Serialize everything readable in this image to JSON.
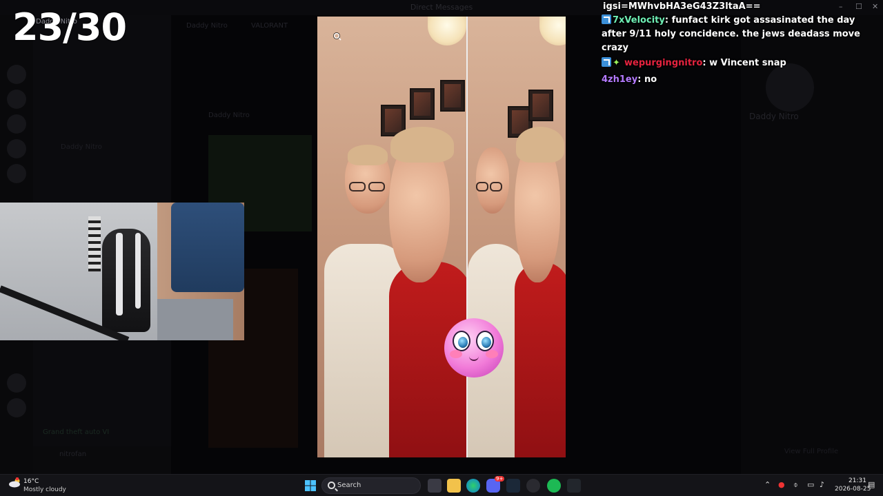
{
  "background": {
    "window_title": "Direct Messages",
    "dm_header_name": "Daddy Nitro",
    "dm_header_channel": "VALORANT",
    "server_name_top": "Daddy Nitro",
    "channel_user": "Daddy Nitro",
    "bg_message_author": "Daddy Nitro",
    "profile_name": "Daddy Nitro",
    "profile_button": "View Full Profile",
    "user_panel_name": "nitrofan",
    "bottom_channel": "Grand theft auto VI"
  },
  "overlay": {
    "counter": "23/30"
  },
  "chat": {
    "lines": [
      {
        "user": "",
        "text": "igsi=MWhvbHA3eG43Z3ltaA=="
      },
      {
        "user": "7xVelocity",
        "text": "funfact kirk got assasinated the day after 9/11 holy concidence. the jews deadass move crazy"
      },
      {
        "user": "wepurgingnitro",
        "text": "w Vincent snap"
      },
      {
        "user": "4zh1ey",
        "text": "no"
      }
    ]
  },
  "taskbar": {
    "weather_temp": "16°C",
    "weather_desc": "Mostly cloudy",
    "search_label": "Search",
    "time": "21:31",
    "date": "2026-08-25",
    "discord_badge": "9+"
  },
  "colors": {
    "chat_user_1": "#6ff0b6",
    "chat_user_2": "#e6233f",
    "chat_user_3": "#b57bff",
    "badge_blue": "#3b8fd8"
  },
  "icons": [
    "magnifier-cursor-icon",
    "moderator-badge-icon",
    "sparkle-badge-icon",
    "windows-start-icon",
    "search-icon",
    "discord-icon",
    "spotify-icon",
    "steam-icon",
    "edge-icon",
    "explorer-icon"
  ]
}
